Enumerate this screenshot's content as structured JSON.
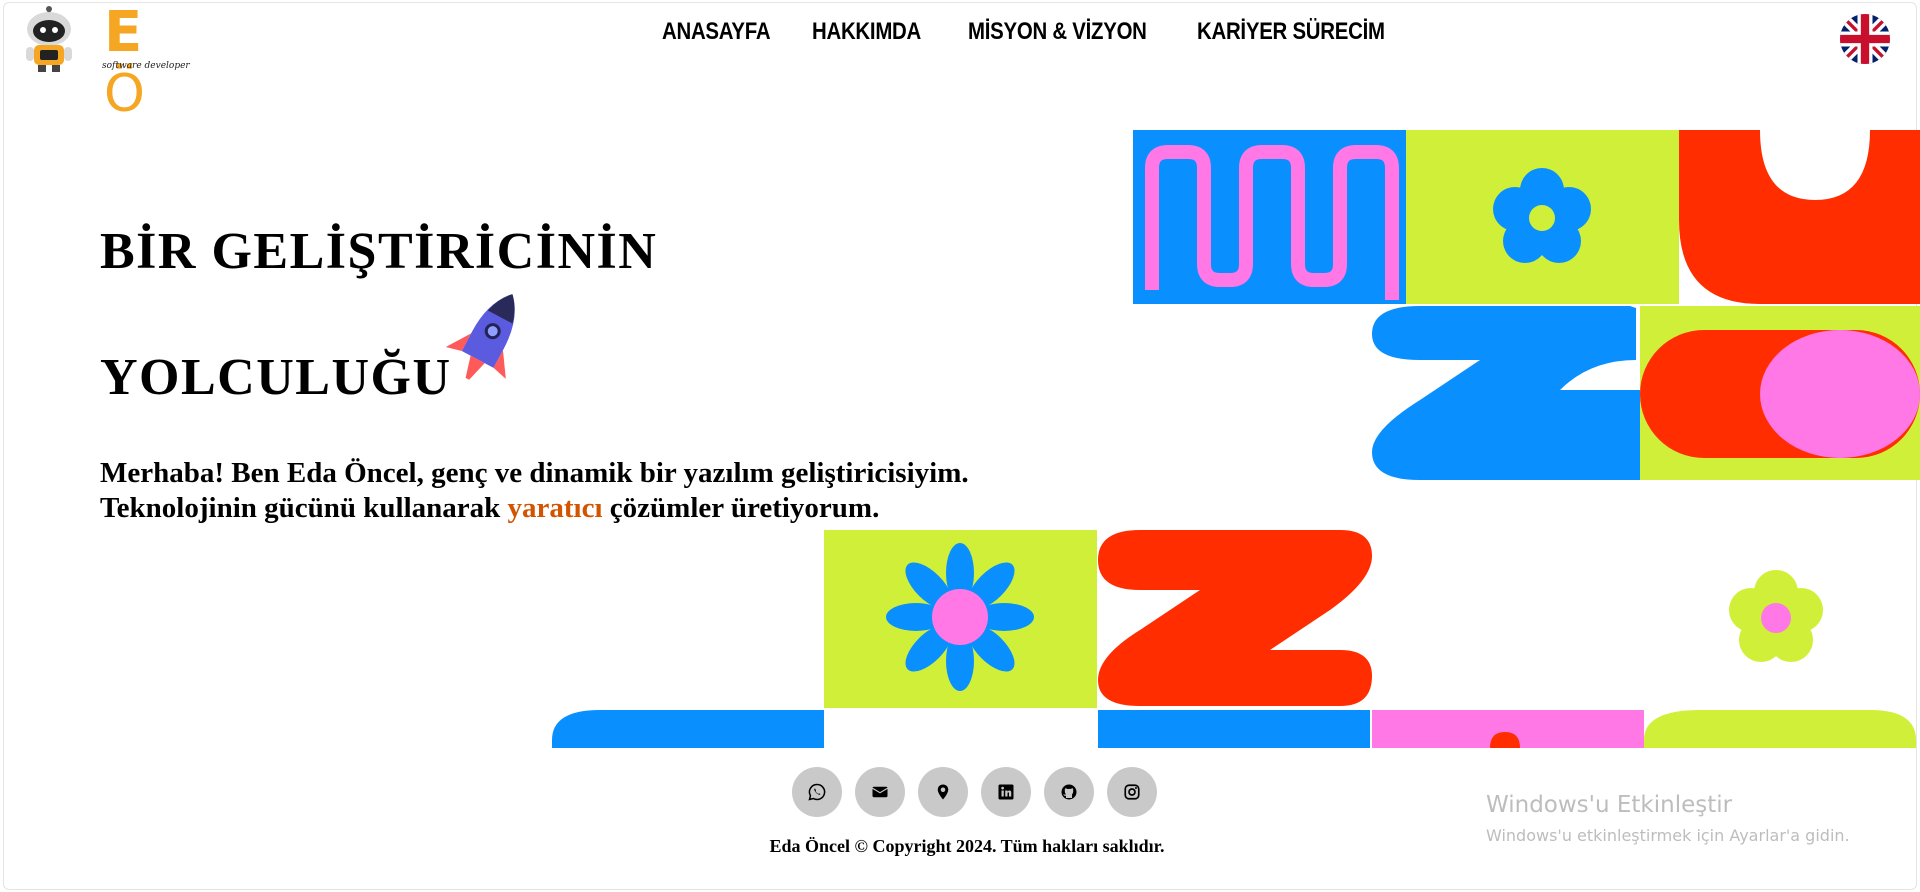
{
  "logo": {
    "text_main": "E",
    "text_o": "Ö",
    "subtitle": "software developer"
  },
  "nav": {
    "items": [
      {
        "label": "ANASAYFA"
      },
      {
        "label": "HAKKIMDA"
      },
      {
        "label": "MİSYON & VİZYON"
      },
      {
        "label": "KARİYER SÜRECİM"
      }
    ],
    "language_icon": "uk-flag-icon"
  },
  "hero": {
    "title_line1": "BİR GELİŞTİRİCİNİN",
    "title_line2": "YOLCULUĞU",
    "title_icon": "rocket-icon",
    "intro_line1": "Merhaba! Ben Eda Öncel, genç ve dinamik bir yazılım geliştiricisiyim.",
    "intro_line2_before": "Teknolojinin gücünü kullanarak ",
    "intro_line2_accent": "yaratıcı",
    "intro_line2_after": " çözümler üretiyorum.",
    "accent_color": "#d35400"
  },
  "art_colors": {
    "blue": "#0a8fff",
    "pink": "#ff78e6",
    "lime": "#d0ef38",
    "red": "#ff2d00"
  },
  "socials": [
    {
      "icon": "whatsapp-icon"
    },
    {
      "icon": "envelope-icon"
    },
    {
      "icon": "map-pin-icon"
    },
    {
      "icon": "linkedin-icon"
    },
    {
      "icon": "github-icon"
    },
    {
      "icon": "instagram-icon"
    }
  ],
  "footer": {
    "copyright": "Eda Öncel © Copyright 2024. Tüm hakları saklıdır."
  },
  "windows_watermark": {
    "title": "Windows'u Etkinleştir",
    "subtitle": "Windows'u etkinleştirmek için Ayarlar'a gidin."
  }
}
